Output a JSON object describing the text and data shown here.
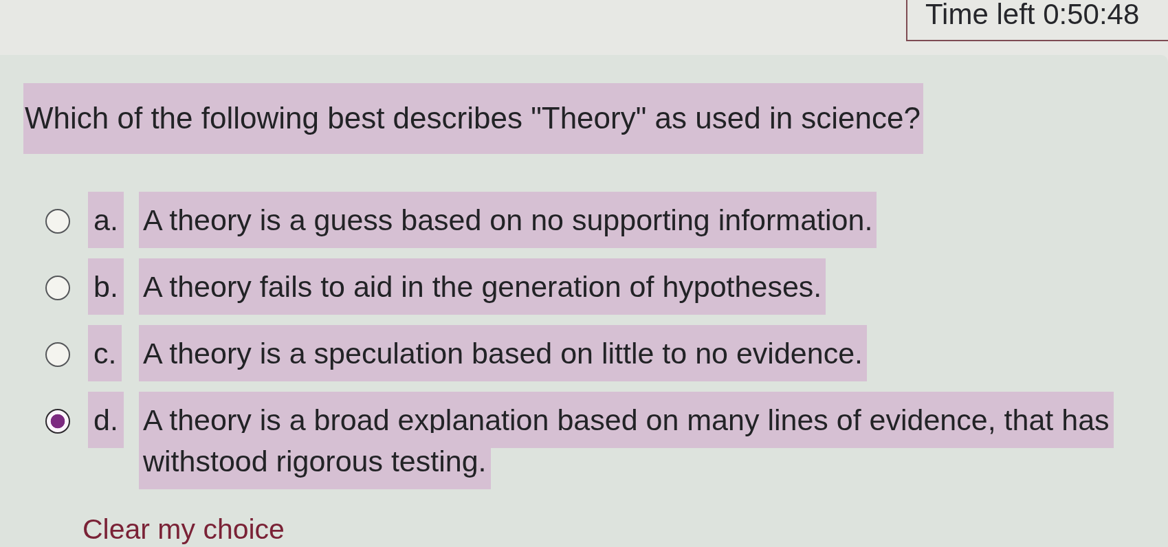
{
  "timer": {
    "label": "Time left 0:50:48"
  },
  "question": {
    "text": "Which of the following best describes \"Theory\" as used in science?"
  },
  "options": [
    {
      "letter": "a.",
      "text": "A theory is a guess based on no supporting information.",
      "selected": false
    },
    {
      "letter": "b.",
      "text": "A theory fails to aid in the generation of hypotheses.",
      "selected": false
    },
    {
      "letter": "c.",
      "text": "A theory is a speculation based on little to no evidence.",
      "selected": false
    },
    {
      "letter": "d.",
      "text": "A theory is a broad explanation based on many lines of evidence, that has withstood rigorous testing.",
      "selected": true
    }
  ],
  "clear_link": {
    "label": "Clear my choice"
  }
}
